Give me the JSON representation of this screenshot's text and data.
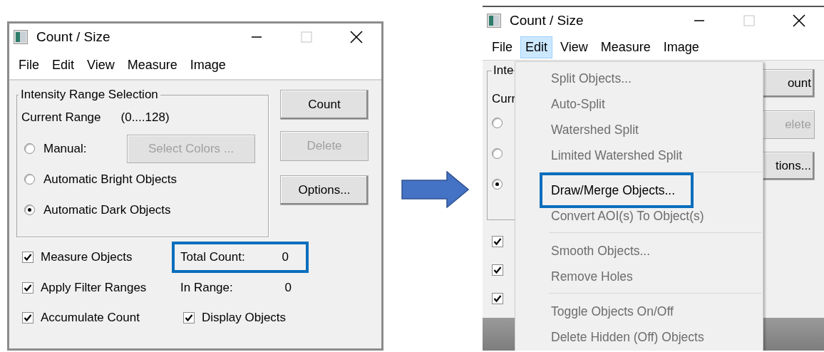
{
  "left_window": {
    "title": "Count / Size",
    "menu": [
      {
        "label": "File",
        "selected": false
      },
      {
        "label": "Edit",
        "selected": false
      },
      {
        "label": "View",
        "selected": false
      },
      {
        "label": "Measure",
        "selected": false
      },
      {
        "label": "Image",
        "selected": false
      }
    ],
    "group": {
      "title": "Intensity Range Selection",
      "range_label": "Current Range",
      "range_value": "(0....128)",
      "radios": [
        {
          "label": "Manual:",
          "selected": false
        },
        {
          "label": "Automatic Bright Objects",
          "selected": false
        },
        {
          "label": "Automatic Dark Objects",
          "selected": true
        }
      ],
      "select_colors": {
        "label": "Select Colors ...",
        "disabled": true
      }
    },
    "buttons": [
      {
        "label": "Count",
        "disabled": false
      },
      {
        "label": "Delete",
        "disabled": true
      },
      {
        "label": "Options...",
        "disabled": false
      }
    ],
    "checkboxes": [
      {
        "label": "Measure Objects",
        "checked": true
      },
      {
        "label": "Apply Filter Ranges",
        "checked": true
      },
      {
        "label": "Accumulate Count",
        "checked": true
      }
    ],
    "total_count": {
      "label": "Total Count:",
      "value": "0",
      "callout": true
    },
    "in_range": {
      "label": "In Range:",
      "value": "0"
    },
    "display_objects": {
      "label": "Display Objects",
      "checked": true
    }
  },
  "right_window": {
    "title": "Count / Size",
    "menu": [
      {
        "label": "File",
        "selected": false
      },
      {
        "label": "Edit",
        "selected": true
      },
      {
        "label": "View",
        "selected": false
      },
      {
        "label": "Measure",
        "selected": false
      },
      {
        "label": "Image",
        "selected": false
      }
    ],
    "group_title": "Inte",
    "range_label": "Curr",
    "radios": [
      {
        "selected": false
      },
      {
        "selected": false
      },
      {
        "selected": true
      }
    ],
    "buttons": [
      {
        "label": "ount",
        "disabled": false
      },
      {
        "label": "elete",
        "disabled": true
      },
      {
        "label": "tions...",
        "disabled": false
      }
    ],
    "checkboxes": [
      {
        "checked": true
      },
      {
        "checked": true
      },
      {
        "checked": true
      }
    ],
    "edit_menu": [
      {
        "kind": "item",
        "label": "Split Objects...",
        "disabled": true,
        "callout": false
      },
      {
        "kind": "item",
        "label": "Auto-Split",
        "disabled": true,
        "callout": false
      },
      {
        "kind": "item",
        "label": "Watershed Split",
        "disabled": true,
        "callout": false
      },
      {
        "kind": "item",
        "label": "Limited Watershed Split",
        "disabled": true,
        "callout": false
      },
      {
        "kind": "separator"
      },
      {
        "kind": "item",
        "label": "Draw/Merge Objects...",
        "disabled": false,
        "callout": true
      },
      {
        "kind": "item",
        "label": "Convert AOI(s) To Object(s)",
        "disabled": true,
        "callout": false
      },
      {
        "kind": "separator"
      },
      {
        "kind": "item",
        "label": "Smooth Objects...",
        "disabled": true,
        "callout": false
      },
      {
        "kind": "item",
        "label": "Remove Holes",
        "disabled": true,
        "callout": false
      },
      {
        "kind": "separator"
      },
      {
        "kind": "item",
        "label": "Toggle Objects On/Off",
        "disabled": true,
        "callout": false
      },
      {
        "kind": "item",
        "label": "Delete Hidden (Off) Objects",
        "disabled": true,
        "callout": false
      }
    ]
  }
}
